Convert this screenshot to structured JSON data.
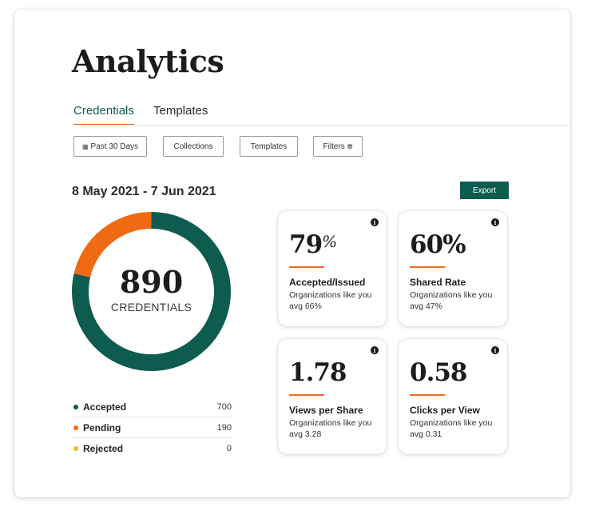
{
  "page": {
    "title": "Analytics"
  },
  "tabs": [
    {
      "label": "Credentials",
      "active": true
    },
    {
      "label": "Templates",
      "active": false
    }
  ],
  "filters": {
    "period": {
      "label": "Past 30 Days",
      "icon": "calendar-icon"
    },
    "collections": {
      "label": "Collections"
    },
    "templates": {
      "label": "Templates"
    },
    "filters": {
      "label": "Filters",
      "icon": "filter-icon"
    }
  },
  "date_range": "8 May 2021 - 7 Jun 2021",
  "export_label": "Export",
  "donut": {
    "total": "890",
    "label": "CREDENTIALS",
    "segments": [
      {
        "name": "Accepted",
        "value": 700,
        "color": "#0e5c50"
      },
      {
        "name": "Pending",
        "value": 190,
        "color": "#f06a14"
      },
      {
        "name": "Rejected",
        "value": 0,
        "color": "#f5b52e"
      }
    ]
  },
  "legend": [
    {
      "name": "Accepted",
      "value": "700",
      "color": "#0e5c50"
    },
    {
      "name": "Pending",
      "value": "190",
      "color": "#f06a14"
    },
    {
      "name": "Rejected",
      "value": "0",
      "color": "#f5b52e"
    }
  ],
  "cards": [
    {
      "value": "79",
      "unit": "%",
      "title": "Accepted/Issued",
      "sub": "Organizations like you avg 66%"
    },
    {
      "value": "60%",
      "unit": "",
      "title": "Shared Rate",
      "sub": "Organizations like you avg 47%"
    },
    {
      "value": "1.78",
      "unit": "",
      "title": "Views per Share",
      "sub": "Organizations like you avg 3.28"
    },
    {
      "value": "0.58",
      "unit": "",
      "title": "Clicks per View",
      "sub": "Organizations like you avg 0.31"
    }
  ],
  "colors": {
    "accent": "#0e5c50",
    "highlight": "#ef6b27"
  }
}
